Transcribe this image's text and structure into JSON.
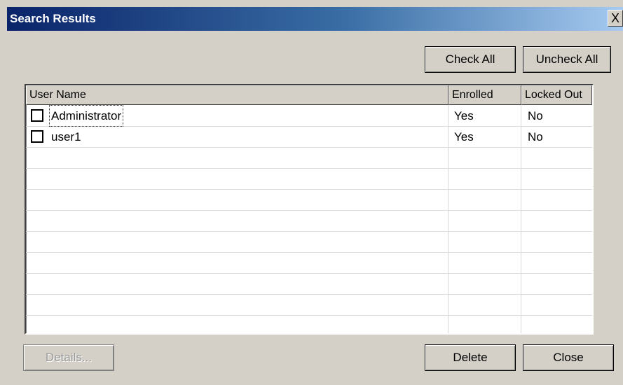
{
  "window": {
    "title": "Search Results",
    "close_label": "X"
  },
  "top_buttons": {
    "check_all": "Check All",
    "uncheck_all": "Uncheck All"
  },
  "listview": {
    "columns": [
      "User Name",
      "Enrolled",
      "Locked Out"
    ],
    "rows": [
      {
        "checked": false,
        "user_name": "Administrator",
        "enrolled": "Yes",
        "locked_out": "No"
      },
      {
        "checked": false,
        "user_name": "user1",
        "enrolled": "Yes",
        "locked_out": "No"
      }
    ]
  },
  "bottom_buttons": {
    "details": "Details...",
    "delete": "Delete",
    "close": "Close"
  },
  "colors": {
    "title_start": "#0a246a",
    "title_end": "#a6caf0",
    "face": "#d4d0c8"
  }
}
